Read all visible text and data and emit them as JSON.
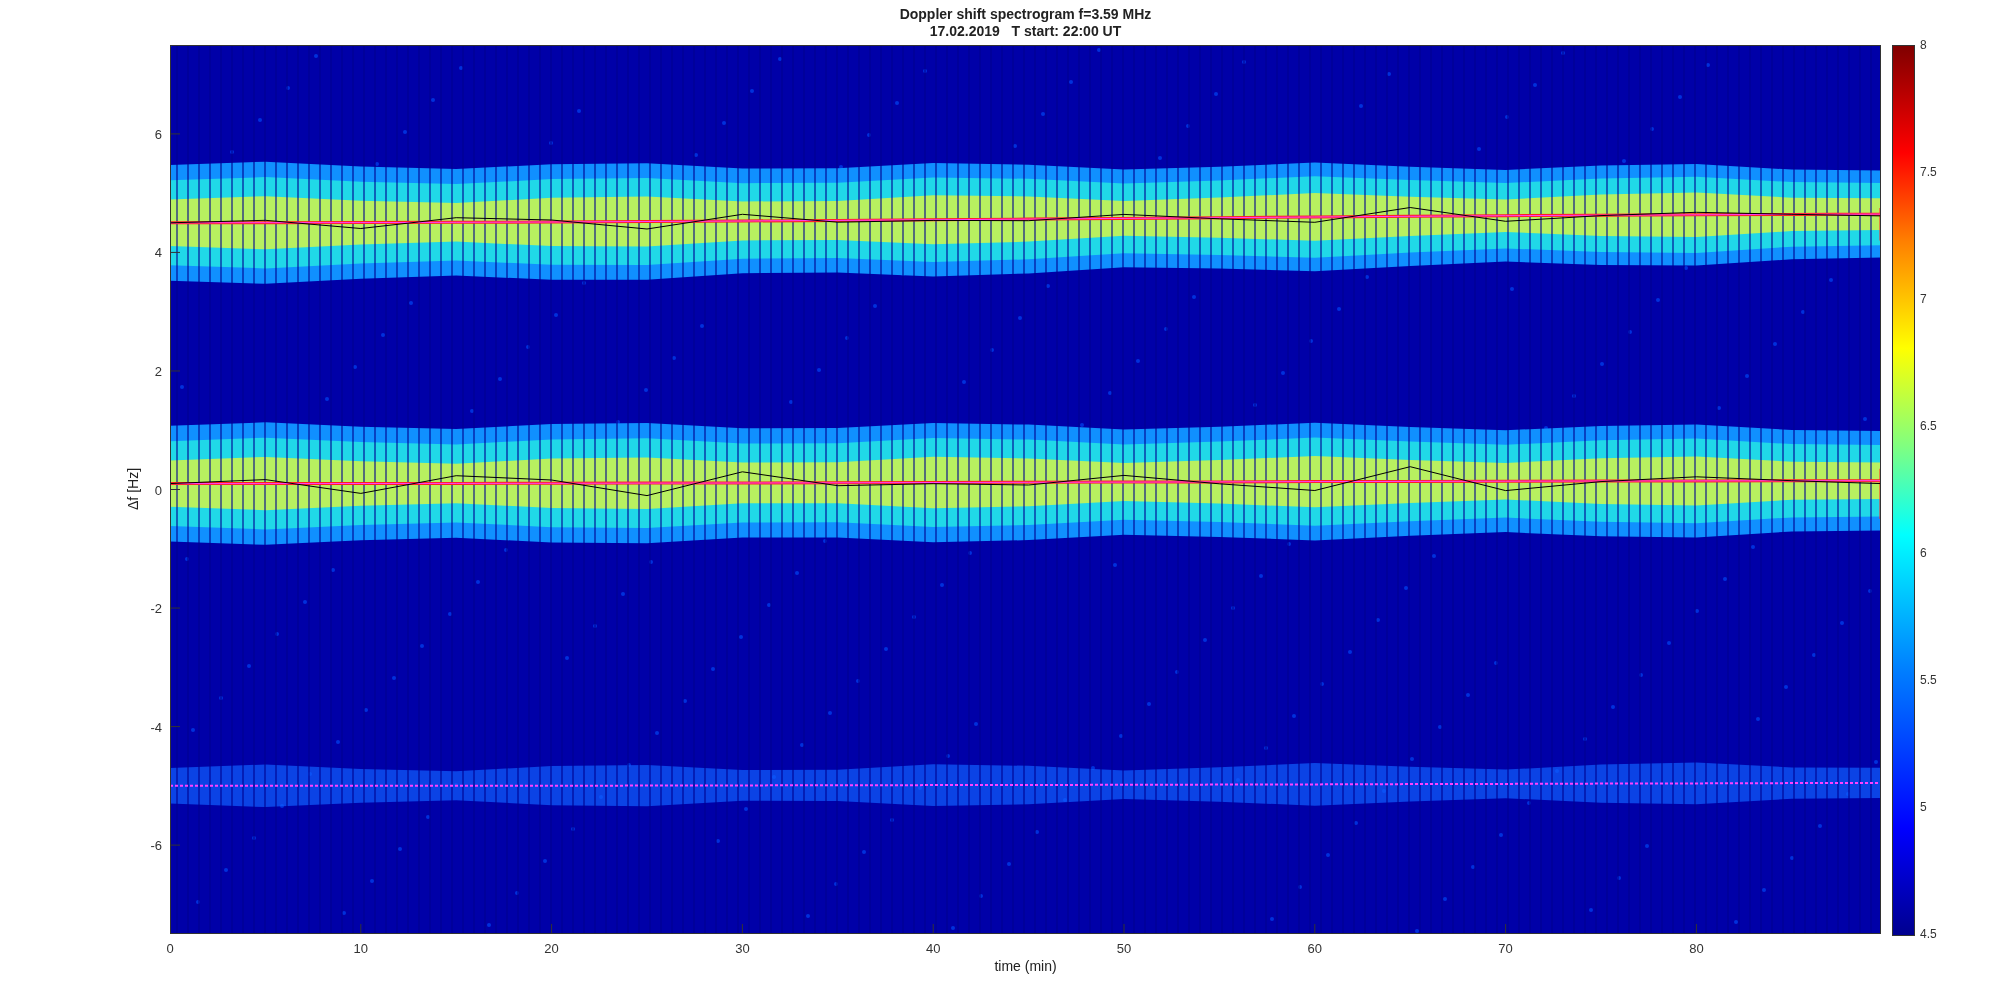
{
  "figure": {
    "title": "Doppler shift spectrogram f=3.59 MHz",
    "subtitle": "17.02.2019   T start: 22:00 UT",
    "ylabel": "Δf [Hz]",
    "xlabel": "time (min)",
    "yticks": [
      "6",
      "4",
      "2",
      "0",
      "-2",
      "-4",
      "-6"
    ],
    "xticks": [
      "0",
      "10",
      "20",
      "30",
      "40",
      "50",
      "60",
      "70",
      "80"
    ],
    "colorbar_ticks": [
      "8",
      "7.5",
      "7",
      "6.5",
      "6",
      "5.5",
      "5",
      "4.5"
    ]
  }
}
